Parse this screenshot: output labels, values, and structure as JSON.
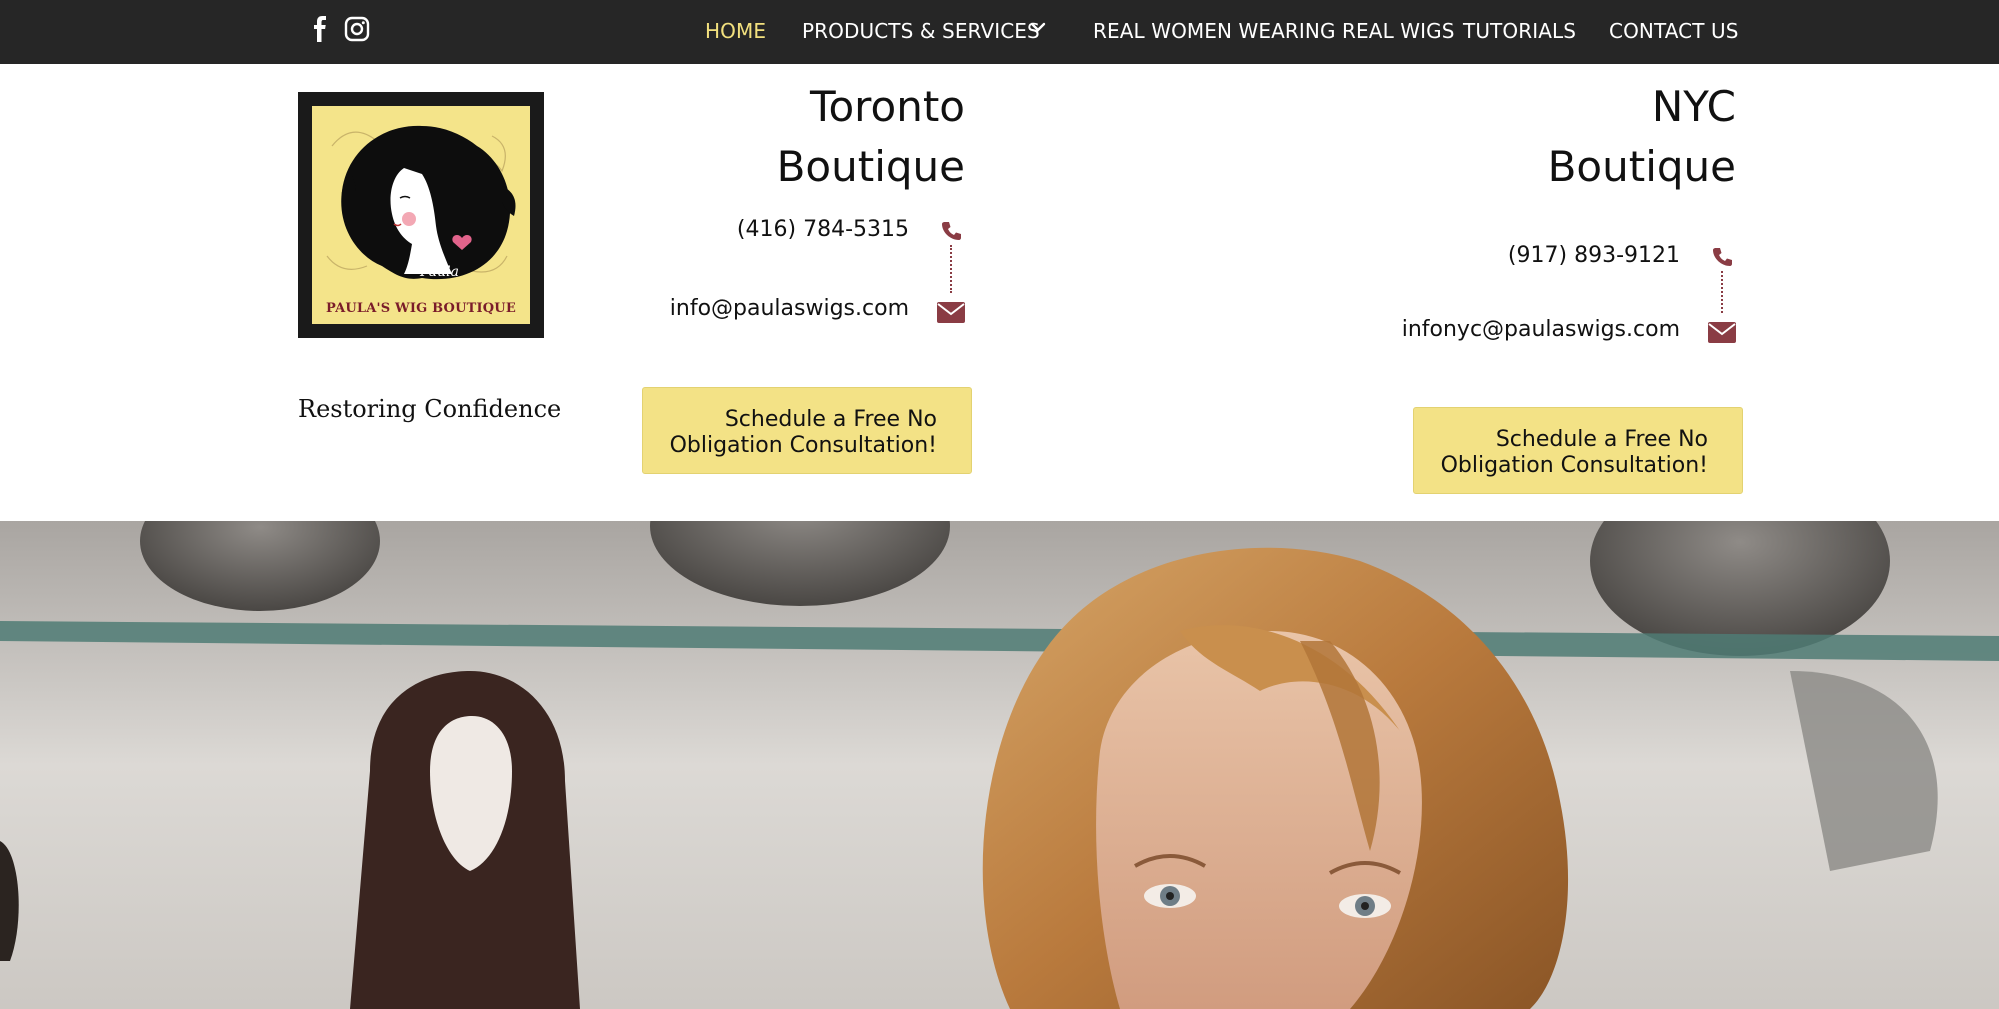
{
  "nav": {
    "items": [
      {
        "label": "HOME",
        "active": true
      },
      {
        "label": "PRODUCTS & SERVICES",
        "has_dropdown": true
      },
      {
        "label": "REAL WOMEN WEARING REAL WIGS"
      },
      {
        "label": "TUTORIALS"
      },
      {
        "label": "CONTACT US"
      }
    ],
    "social": [
      "facebook-icon",
      "instagram-icon"
    ]
  },
  "logo": {
    "brand": "PAULA'S WIG BOUTIQUE",
    "signature": "Paula"
  },
  "tagline": "Restoring Confidence",
  "toronto": {
    "title_line1": "Toronto",
    "title_line2": "Boutique",
    "phone": "(416) 784-5315",
    "email": "info@paulaswigs.com",
    "cta": "Schedule a Free No Obligation Consultation!"
  },
  "nyc": {
    "title_line1": "NYC",
    "title_line2": "Boutique",
    "phone": "(917) 893-9121",
    "email": "infonyc@paulaswigs.com",
    "cta": "Schedule a Free No Obligation Consultation!"
  },
  "colors": {
    "nav_bg": "#262626",
    "nav_active": "#f2e07e",
    "cta_bg": "#f3e286",
    "icon_accent": "#8a3c44"
  }
}
